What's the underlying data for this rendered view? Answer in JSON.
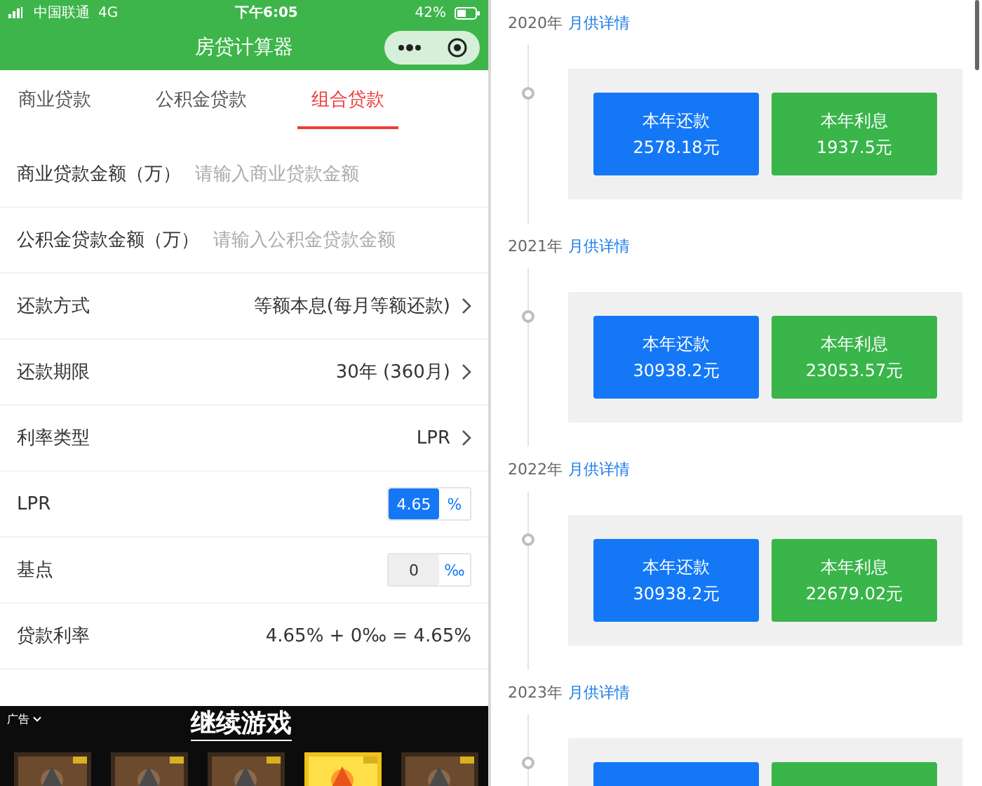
{
  "left": {
    "status_bar": {
      "carrier": "中国联通",
      "network": "4G",
      "time": "下午6:05",
      "battery": "42%"
    },
    "nav": {
      "title": "房贷计算器"
    },
    "tabs": [
      {
        "label": "商业贷款",
        "selected": false
      },
      {
        "label": "公积金贷款",
        "selected": false
      },
      {
        "label": "组合贷款",
        "selected": true
      }
    ],
    "rows": [
      {
        "kind": "input",
        "label": "商业贷款金额（万）",
        "placeholder": "请输入商业贷款金额"
      },
      {
        "kind": "input",
        "label": "公积金贷款金额（万）",
        "placeholder": "请输入公积金贷款金额"
      },
      {
        "kind": "select",
        "label": "还款方式",
        "value": "等额本息(每月等额还款)"
      },
      {
        "kind": "select",
        "label": "还款期限",
        "value": "30年 (360月)"
      },
      {
        "kind": "select",
        "label": "利率类型",
        "value": "LPR"
      },
      {
        "kind": "unit",
        "label": "LPR",
        "value": "4.65",
        "unit": "%",
        "highlighted": true
      },
      {
        "kind": "unit",
        "label": "基点",
        "value": "0",
        "unit": "‰",
        "highlighted": false
      },
      {
        "kind": "text",
        "label": "贷款利率",
        "value": "4.65% + 0‰ = 4.65%"
      }
    ],
    "ad": {
      "label": "广告",
      "title": "继续游戏"
    }
  },
  "right": {
    "years": [
      {
        "year": "2020年",
        "link": "月供详情",
        "stats": [
          {
            "kind": "payment",
            "label": "本年还款",
            "value": "2578.18元"
          },
          {
            "kind": "interest",
            "label": "本年利息",
            "value": "1937.5元"
          }
        ]
      },
      {
        "year": "2021年",
        "link": "月供详情",
        "stats": [
          {
            "kind": "payment",
            "label": "本年还款",
            "value": "30938.2元"
          },
          {
            "kind": "interest",
            "label": "本年利息",
            "value": "23053.57元"
          }
        ]
      },
      {
        "year": "2022年",
        "link": "月供详情",
        "stats": [
          {
            "kind": "payment",
            "label": "本年还款",
            "value": "30938.2元"
          },
          {
            "kind": "interest",
            "label": "本年利息",
            "value": "22679.02元"
          }
        ]
      },
      {
        "year": "2023年",
        "link": "月供详情",
        "stats": [
          {
            "kind": "payment"
          },
          {
            "kind": "interest"
          }
        ]
      }
    ]
  }
}
